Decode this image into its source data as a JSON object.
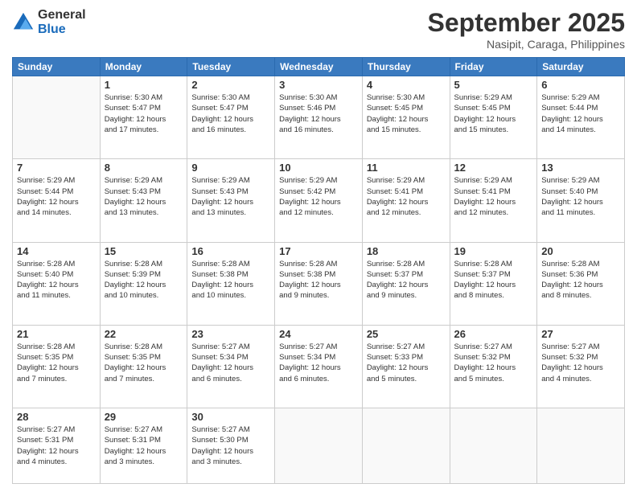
{
  "logo": {
    "general": "General",
    "blue": "Blue"
  },
  "title": "September 2025",
  "location": "Nasipit, Caraga, Philippines",
  "headers": [
    "Sunday",
    "Monday",
    "Tuesday",
    "Wednesday",
    "Thursday",
    "Friday",
    "Saturday"
  ],
  "weeks": [
    [
      {
        "day": "",
        "info": ""
      },
      {
        "day": "1",
        "info": "Sunrise: 5:30 AM\nSunset: 5:47 PM\nDaylight: 12 hours\nand 17 minutes."
      },
      {
        "day": "2",
        "info": "Sunrise: 5:30 AM\nSunset: 5:47 PM\nDaylight: 12 hours\nand 16 minutes."
      },
      {
        "day": "3",
        "info": "Sunrise: 5:30 AM\nSunset: 5:46 PM\nDaylight: 12 hours\nand 16 minutes."
      },
      {
        "day": "4",
        "info": "Sunrise: 5:30 AM\nSunset: 5:45 PM\nDaylight: 12 hours\nand 15 minutes."
      },
      {
        "day": "5",
        "info": "Sunrise: 5:29 AM\nSunset: 5:45 PM\nDaylight: 12 hours\nand 15 minutes."
      },
      {
        "day": "6",
        "info": "Sunrise: 5:29 AM\nSunset: 5:44 PM\nDaylight: 12 hours\nand 14 minutes."
      }
    ],
    [
      {
        "day": "7",
        "info": "Sunrise: 5:29 AM\nSunset: 5:44 PM\nDaylight: 12 hours\nand 14 minutes."
      },
      {
        "day": "8",
        "info": "Sunrise: 5:29 AM\nSunset: 5:43 PM\nDaylight: 12 hours\nand 13 minutes."
      },
      {
        "day": "9",
        "info": "Sunrise: 5:29 AM\nSunset: 5:43 PM\nDaylight: 12 hours\nand 13 minutes."
      },
      {
        "day": "10",
        "info": "Sunrise: 5:29 AM\nSunset: 5:42 PM\nDaylight: 12 hours\nand 12 minutes."
      },
      {
        "day": "11",
        "info": "Sunrise: 5:29 AM\nSunset: 5:41 PM\nDaylight: 12 hours\nand 12 minutes."
      },
      {
        "day": "12",
        "info": "Sunrise: 5:29 AM\nSunset: 5:41 PM\nDaylight: 12 hours\nand 12 minutes."
      },
      {
        "day": "13",
        "info": "Sunrise: 5:29 AM\nSunset: 5:40 PM\nDaylight: 12 hours\nand 11 minutes."
      }
    ],
    [
      {
        "day": "14",
        "info": "Sunrise: 5:28 AM\nSunset: 5:40 PM\nDaylight: 12 hours\nand 11 minutes."
      },
      {
        "day": "15",
        "info": "Sunrise: 5:28 AM\nSunset: 5:39 PM\nDaylight: 12 hours\nand 10 minutes."
      },
      {
        "day": "16",
        "info": "Sunrise: 5:28 AM\nSunset: 5:38 PM\nDaylight: 12 hours\nand 10 minutes."
      },
      {
        "day": "17",
        "info": "Sunrise: 5:28 AM\nSunset: 5:38 PM\nDaylight: 12 hours\nand 9 minutes."
      },
      {
        "day": "18",
        "info": "Sunrise: 5:28 AM\nSunset: 5:37 PM\nDaylight: 12 hours\nand 9 minutes."
      },
      {
        "day": "19",
        "info": "Sunrise: 5:28 AM\nSunset: 5:37 PM\nDaylight: 12 hours\nand 8 minutes."
      },
      {
        "day": "20",
        "info": "Sunrise: 5:28 AM\nSunset: 5:36 PM\nDaylight: 12 hours\nand 8 minutes."
      }
    ],
    [
      {
        "day": "21",
        "info": "Sunrise: 5:28 AM\nSunset: 5:35 PM\nDaylight: 12 hours\nand 7 minutes."
      },
      {
        "day": "22",
        "info": "Sunrise: 5:28 AM\nSunset: 5:35 PM\nDaylight: 12 hours\nand 7 minutes."
      },
      {
        "day": "23",
        "info": "Sunrise: 5:27 AM\nSunset: 5:34 PM\nDaylight: 12 hours\nand 6 minutes."
      },
      {
        "day": "24",
        "info": "Sunrise: 5:27 AM\nSunset: 5:34 PM\nDaylight: 12 hours\nand 6 minutes."
      },
      {
        "day": "25",
        "info": "Sunrise: 5:27 AM\nSunset: 5:33 PM\nDaylight: 12 hours\nand 5 minutes."
      },
      {
        "day": "26",
        "info": "Sunrise: 5:27 AM\nSunset: 5:32 PM\nDaylight: 12 hours\nand 5 minutes."
      },
      {
        "day": "27",
        "info": "Sunrise: 5:27 AM\nSunset: 5:32 PM\nDaylight: 12 hours\nand 4 minutes."
      }
    ],
    [
      {
        "day": "28",
        "info": "Sunrise: 5:27 AM\nSunset: 5:31 PM\nDaylight: 12 hours\nand 4 minutes."
      },
      {
        "day": "29",
        "info": "Sunrise: 5:27 AM\nSunset: 5:31 PM\nDaylight: 12 hours\nand 3 minutes."
      },
      {
        "day": "30",
        "info": "Sunrise: 5:27 AM\nSunset: 5:30 PM\nDaylight: 12 hours\nand 3 minutes."
      },
      {
        "day": "",
        "info": ""
      },
      {
        "day": "",
        "info": ""
      },
      {
        "day": "",
        "info": ""
      },
      {
        "day": "",
        "info": ""
      }
    ]
  ]
}
